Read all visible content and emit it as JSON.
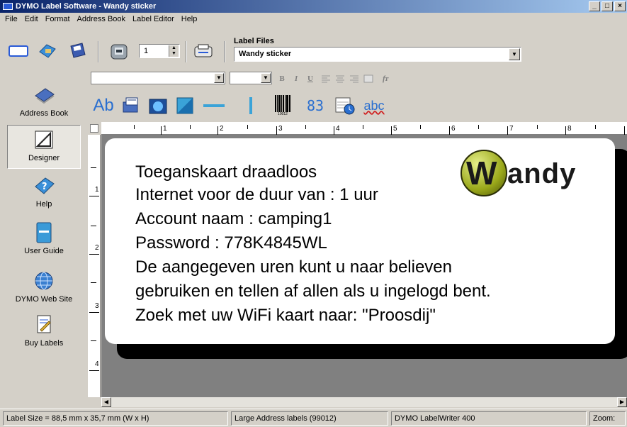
{
  "window": {
    "title": "DYMO Label Software - Wandy sticker",
    "controls": [
      "_",
      "□",
      "×"
    ]
  },
  "menu": [
    "File",
    "Edit",
    "Format",
    "Address Book",
    "Label Editor",
    "Help"
  ],
  "toolbar": {
    "copies": "1",
    "label_files_caption": "Label Files",
    "label_file": "Wandy sticker"
  },
  "sidebar": {
    "items": [
      {
        "label": "Address Book",
        "icon": "address-book-icon"
      },
      {
        "label": "Designer",
        "icon": "designer-icon"
      },
      {
        "label": "Help",
        "icon": "help-icon"
      },
      {
        "label": "User Guide",
        "icon": "user-guide-icon"
      },
      {
        "label": "DYMO Web Site",
        "icon": "globe-icon"
      },
      {
        "label": "Buy Labels",
        "icon": "buy-labels-icon"
      }
    ]
  },
  "format_toolbar": {
    "font": "",
    "size": "",
    "bold": "B",
    "italic": "I",
    "underline": "U",
    "fit": "fᴛ"
  },
  "object_toolbar": {
    "text_tool": "Ab",
    "counter_tool": "83",
    "spell_tool": "abc",
    "barcode_caption": "10012"
  },
  "ruler": {
    "top": [
      "1",
      "2",
      "3",
      "4",
      "5",
      "6",
      "7",
      "8"
    ],
    "left": [
      "1",
      "2",
      "3",
      "4"
    ]
  },
  "label": {
    "logo_text": "andy",
    "logo_letter": "W",
    "lines": [
      "Toeganskaart draadloos",
      "Internet voor de duur van : 1 uur",
      "Account naam  : camping1",
      "Password          : 778K4845WL",
      "De aangegeven uren kunt u naar believen",
      "gebruiken en tellen af allen als u ingelogd bent.",
      "Zoek met uw WiFi kaart naar: \"Proosdij\""
    ]
  },
  "status": {
    "size": "Label Size = 88,5 mm x 35,7 mm (W x H)",
    "type": "Large Address labels (99012)",
    "printer": "DYMO LabelWriter 400",
    "zoom": "Zoom:"
  }
}
